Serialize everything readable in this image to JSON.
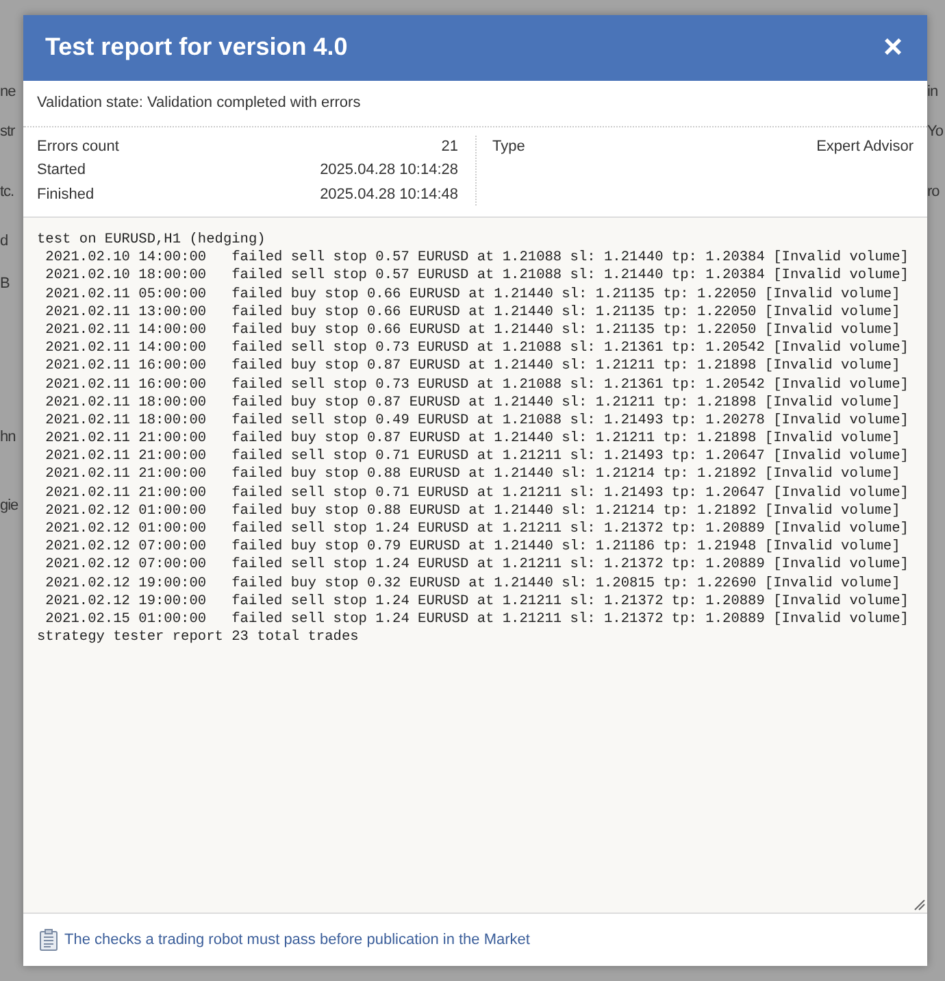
{
  "background": {
    "left_fragments": [
      "ne",
      "str",
      "tc.",
      "d",
      "B",
      "hn",
      "gie"
    ],
    "right_fragments": [
      "in",
      "Yo",
      "ro"
    ]
  },
  "dialog": {
    "title": "Test report for version 4.0",
    "close": "×",
    "validation_state": "Validation state: Validation completed with errors",
    "stats_left": [
      {
        "label": "Errors count",
        "value": "21"
      },
      {
        "label": "Started",
        "value": "2025.04.28 10:14:28"
      },
      {
        "label": "Finished",
        "value": "2025.04.28 10:14:48"
      }
    ],
    "stats_right": [
      {
        "label": "Type",
        "value": "Expert Advisor"
      }
    ],
    "log": [
      "test on EURUSD,H1 (hedging)",
      " 2021.02.10 14:00:00   failed sell stop 0.57 EURUSD at 1.21088 sl: 1.21440 tp: 1.20384 [Invalid volume]",
      " 2021.02.10 18:00:00   failed sell stop 0.57 EURUSD at 1.21088 sl: 1.21440 tp: 1.20384 [Invalid volume]",
      " 2021.02.11 05:00:00   failed buy stop 0.66 EURUSD at 1.21440 sl: 1.21135 tp: 1.22050 [Invalid volume]",
      " 2021.02.11 13:00:00   failed buy stop 0.66 EURUSD at 1.21440 sl: 1.21135 tp: 1.22050 [Invalid volume]",
      " 2021.02.11 14:00:00   failed buy stop 0.66 EURUSD at 1.21440 sl: 1.21135 tp: 1.22050 [Invalid volume]",
      " 2021.02.11 14:00:00   failed sell stop 0.73 EURUSD at 1.21088 sl: 1.21361 tp: 1.20542 [Invalid volume]",
      " 2021.02.11 16:00:00   failed buy stop 0.87 EURUSD at 1.21440 sl: 1.21211 tp: 1.21898 [Invalid volume]",
      " 2021.02.11 16:00:00   failed sell stop 0.73 EURUSD at 1.21088 sl: 1.21361 tp: 1.20542 [Invalid volume]",
      " 2021.02.11 18:00:00   failed buy stop 0.87 EURUSD at 1.21440 sl: 1.21211 tp: 1.21898 [Invalid volume]",
      " 2021.02.11 18:00:00   failed sell stop 0.49 EURUSD at 1.21088 sl: 1.21493 tp: 1.20278 [Invalid volume]",
      " 2021.02.11 21:00:00   failed buy stop 0.87 EURUSD at 1.21440 sl: 1.21211 tp: 1.21898 [Invalid volume]",
      " 2021.02.11 21:00:00   failed sell stop 0.71 EURUSD at 1.21211 sl: 1.21493 tp: 1.20647 [Invalid volume]",
      " 2021.02.11 21:00:00   failed buy stop 0.88 EURUSD at 1.21440 sl: 1.21214 tp: 1.21892 [Invalid volume]",
      " 2021.02.11 21:00:00   failed sell stop 0.71 EURUSD at 1.21211 sl: 1.21493 tp: 1.20647 [Invalid volume]",
      " 2021.02.12 01:00:00   failed buy stop 0.88 EURUSD at 1.21440 sl: 1.21214 tp: 1.21892 [Invalid volume]",
      " 2021.02.12 01:00:00   failed sell stop 1.24 EURUSD at 1.21211 sl: 1.21372 tp: 1.20889 [Invalid volume]",
      " 2021.02.12 07:00:00   failed buy stop 0.79 EURUSD at 1.21440 sl: 1.21186 tp: 1.21948 [Invalid volume]",
      " 2021.02.12 07:00:00   failed sell stop 1.24 EURUSD at 1.21211 sl: 1.21372 tp: 1.20889 [Invalid volume]",
      " 2021.02.12 19:00:00   failed buy stop 0.32 EURUSD at 1.21440 sl: 1.20815 tp: 1.22690 [Invalid volume]",
      " 2021.02.12 19:00:00   failed sell stop 1.24 EURUSD at 1.21211 sl: 1.21372 tp: 1.20889 [Invalid volume]",
      " 2021.02.15 01:00:00   failed sell stop 1.24 EURUSD at 1.21211 sl: 1.21372 tp: 1.20889 [Invalid volume]",
      "strategy tester report 23 total trades"
    ],
    "footer_link": "The checks a trading robot must pass before publication in the Market"
  }
}
